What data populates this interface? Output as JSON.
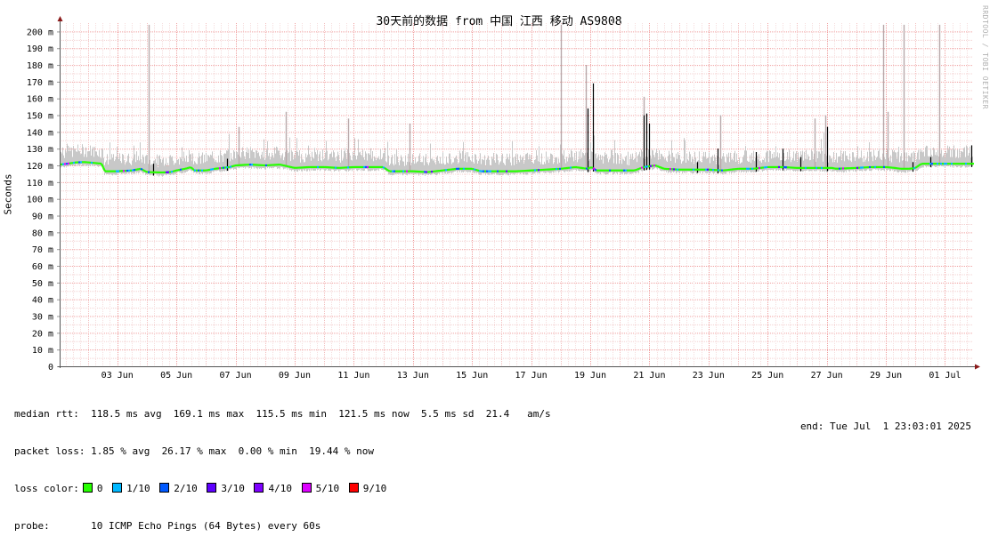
{
  "chart_data": {
    "type": "line",
    "title": "30天前的数据 from 中国 江西 移动 AS9808",
    "ylabel": "Seconds",
    "watermark": "RRDTOOL / TOBI OETIKER",
    "ylim": [
      0,
      205
    ],
    "y_ticks": [
      0,
      10,
      20,
      30,
      40,
      50,
      60,
      70,
      80,
      90,
      100,
      110,
      120,
      130,
      140,
      150,
      160,
      170,
      180,
      190,
      200
    ],
    "y_tick_labels": [
      "0",
      "10 m",
      "20 m",
      "30 m",
      "40 m",
      "50 m",
      "60 m",
      "70 m",
      "80 m",
      "90 m",
      "100 m",
      "110 m",
      "120 m",
      "130 m",
      "140 m",
      "150 m",
      "160 m",
      "170 m",
      "180 m",
      "190 m",
      "200 m"
    ],
    "x_range_days": [
      1.05,
      31.95
    ],
    "x_ticks": [
      {
        "day": 3,
        "label": "03 Jun"
      },
      {
        "day": 5,
        "label": "05 Jun"
      },
      {
        "day": 7,
        "label": "07 Jun"
      },
      {
        "day": 9,
        "label": "09 Jun"
      },
      {
        "day": 11,
        "label": "11 Jun"
      },
      {
        "day": 13,
        "label": "13 Jun"
      },
      {
        "day": 15,
        "label": "15 Jun"
      },
      {
        "day": 17,
        "label": "17 Jun"
      },
      {
        "day": 19,
        "label": "19 Jun"
      },
      {
        "day": 21,
        "label": "21 Jun"
      },
      {
        "day": 23,
        "label": "23 Jun"
      },
      {
        "day": 25,
        "label": "25 Jun"
      },
      {
        "day": 27,
        "label": "27 Jun"
      },
      {
        "day": 29,
        "label": "29 Jun"
      },
      {
        "day": 31,
        "label": "01 Jul"
      }
    ],
    "grid": true,
    "series": [
      {
        "name": "median rtt",
        "unit": "ms",
        "points": [
          [
            1.05,
            120.5
          ],
          [
            1.3,
            121
          ],
          [
            1.6,
            121.8
          ],
          [
            1.9,
            122
          ],
          [
            2.2,
            121.5
          ],
          [
            2.5,
            121
          ],
          [
            2.55,
            116.5
          ],
          [
            3.0,
            116.5
          ],
          [
            3.5,
            117
          ],
          [
            3.8,
            118
          ],
          [
            4.0,
            116
          ],
          [
            4.5,
            115.8
          ],
          [
            4.8,
            116
          ],
          [
            5.0,
            117
          ],
          [
            5.3,
            118
          ],
          [
            5.5,
            119
          ],
          [
            5.6,
            117
          ],
          [
            6.0,
            117
          ],
          [
            6.3,
            118
          ],
          [
            6.8,
            119
          ],
          [
            7.0,
            120
          ],
          [
            7.5,
            120.5
          ],
          [
            8.0,
            120
          ],
          [
            8.5,
            120.5
          ],
          [
            9.0,
            118.5
          ],
          [
            9.5,
            119
          ],
          [
            10.0,
            119
          ],
          [
            10.5,
            118.5
          ],
          [
            11.0,
            119
          ],
          [
            11.5,
            119
          ],
          [
            12.0,
            119
          ],
          [
            12.2,
            116.5
          ],
          [
            12.5,
            116.5
          ],
          [
            13.0,
            116.5
          ],
          [
            13.5,
            116
          ],
          [
            14.0,
            117
          ],
          [
            14.5,
            118
          ],
          [
            15.0,
            118
          ],
          [
            15.3,
            116.5
          ],
          [
            16.0,
            116.5
          ],
          [
            16.5,
            116.5
          ],
          [
            17.0,
            117
          ],
          [
            17.5,
            117.5
          ],
          [
            18.0,
            118
          ],
          [
            18.5,
            119
          ],
          [
            18.9,
            118
          ],
          [
            19.05,
            119
          ],
          [
            19.2,
            117
          ],
          [
            19.5,
            117
          ],
          [
            20.0,
            117
          ],
          [
            20.5,
            117
          ],
          [
            20.8,
            119
          ],
          [
            21.2,
            120
          ],
          [
            21.5,
            118
          ],
          [
            22.0,
            117.5
          ],
          [
            22.5,
            117.5
          ],
          [
            23.0,
            117.5
          ],
          [
            23.5,
            117
          ],
          [
            24.0,
            118
          ],
          [
            24.5,
            118
          ],
          [
            25.0,
            119
          ],
          [
            25.5,
            119
          ],
          [
            26.0,
            118.5
          ],
          [
            26.5,
            118.5
          ],
          [
            27.0,
            118.5
          ],
          [
            27.2,
            118.5
          ],
          [
            27.3,
            118
          ],
          [
            28.0,
            118.5
          ],
          [
            28.5,
            119
          ],
          [
            29.0,
            119
          ],
          [
            29.3,
            118.5
          ],
          [
            29.5,
            118
          ],
          [
            29.8,
            118
          ],
          [
            30.0,
            118.5
          ],
          [
            30.2,
            121
          ],
          [
            30.5,
            121
          ],
          [
            31.0,
            121
          ],
          [
            31.5,
            121
          ],
          [
            31.95,
            121
          ]
        ]
      }
    ],
    "max_spikes": [
      {
        "day": 4.05,
        "value": 204
      },
      {
        "day": 12.9,
        "value": 145
      },
      {
        "day": 18.0,
        "value": 204
      },
      {
        "day": 18.85,
        "value": 180
      },
      {
        "day": 20.8,
        "value": 161
      },
      {
        "day": 26.95,
        "value": 150
      },
      {
        "day": 28.9,
        "value": 204
      },
      {
        "day": 29.05,
        "value": 152
      },
      {
        "day": 29.6,
        "value": 204
      },
      {
        "day": 30.8,
        "value": 204
      },
      {
        "day": 7.1,
        "value": 143
      },
      {
        "day": 8.7,
        "value": 152
      },
      {
        "day": 10.8,
        "value": 148
      },
      {
        "day": 23.4,
        "value": 150
      },
      {
        "day": 26.6,
        "value": 148
      }
    ]
  },
  "legend": {
    "median_rtt": "median rtt:  118.5 ms avg  169.1 ms max  115.5 ms min  121.5 ms now  5.5 ms sd  21.4   am/s",
    "packet_loss": "packet loss: 1.85 % avg  26.17 % max  0.00 % min  19.44 % now",
    "loss_color_label": "loss color:",
    "loss_colors": [
      {
        "label": "0",
        "color": "#26ff00"
      },
      {
        "label": "1/10",
        "color": "#00b8ff"
      },
      {
        "label": "2/10",
        "color": "#0059ff"
      },
      {
        "label": "3/10",
        "color": "#5e00ff"
      },
      {
        "label": "4/10",
        "color": "#7e00ff"
      },
      {
        "label": "5/10",
        "color": "#dd00ff"
      },
      {
        "label": "9/10",
        "color": "#ff0000"
      }
    ],
    "probe": "probe:       10 ICMP Echo Pings (64 Bytes) every 60s",
    "end": "end: Tue Jul  1 23:03:01 2025"
  }
}
